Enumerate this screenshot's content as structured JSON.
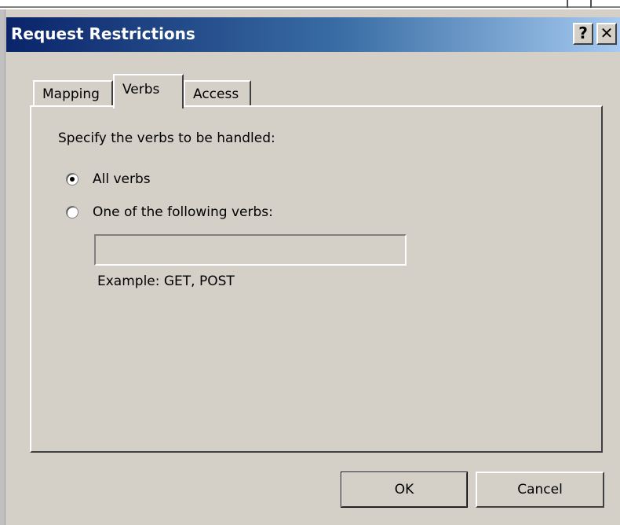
{
  "dialog": {
    "title": "Request Restrictions",
    "help_label": "?",
    "close_label": "✕"
  },
  "tabs": [
    {
      "label": "Mapping",
      "active": false
    },
    {
      "label": "Verbs",
      "active": true
    },
    {
      "label": "Access",
      "active": false
    }
  ],
  "verbs_panel": {
    "heading": "Specify the verbs to be handled:",
    "options": [
      {
        "label": "All verbs",
        "selected": true
      },
      {
        "label": "One of the following verbs:",
        "selected": false
      }
    ],
    "verbs_input_value": "",
    "example_text": "Example: GET, POST"
  },
  "buttons": {
    "ok_label": "OK",
    "cancel_label": "Cancel"
  },
  "colors": {
    "titlebar_start": "#0a246a",
    "titlebar_end": "#a6caf0",
    "face": "#d4d0c8"
  },
  "icons": [
    "help-icon",
    "close-icon",
    "radio-selected-icon",
    "radio-unselected-icon"
  ]
}
